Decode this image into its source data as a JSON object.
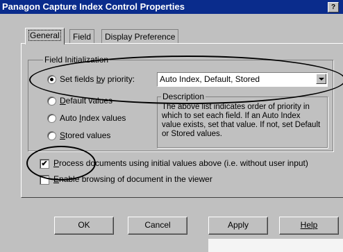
{
  "window": {
    "title": "Panagon Capture Index Control Properties",
    "help_button": "?"
  },
  "tabs": [
    {
      "label": "General",
      "active": true
    },
    {
      "label": "Field",
      "active": false
    },
    {
      "label": "Display Preference",
      "active": false
    }
  ],
  "field_initialization": {
    "group_label": "Field Initialization",
    "radios": [
      {
        "pre": "Set fields ",
        "accel": "b",
        "post": "y priority:",
        "checked": true
      },
      {
        "pre": "",
        "accel": "D",
        "post": "efault values",
        "checked": false
      },
      {
        "pre": "Auto ",
        "accel": "I",
        "post": "ndex values",
        "checked": false
      },
      {
        "pre": "",
        "accel": "S",
        "post": "tored values",
        "checked": false
      }
    ],
    "priority_select": {
      "value": "Auto Index, Default, Stored"
    },
    "description": {
      "label": "Description",
      "text": "The above list indicates order of priority in which to set each field.  If an Auto Index value exists, set that value.  If not, set Default or Stored values."
    }
  },
  "options": {
    "process": {
      "accel": "P",
      "post": "rocess documents using initial values above (i.e. without user input)",
      "checked": true,
      "mark": "✔"
    },
    "browse": {
      "accel": "E",
      "post": "nable browsing of document in the viewer",
      "checked": false
    }
  },
  "buttons": {
    "ok": "OK",
    "cancel": "Cancel",
    "apply": "Apply",
    "help": "Help"
  }
}
